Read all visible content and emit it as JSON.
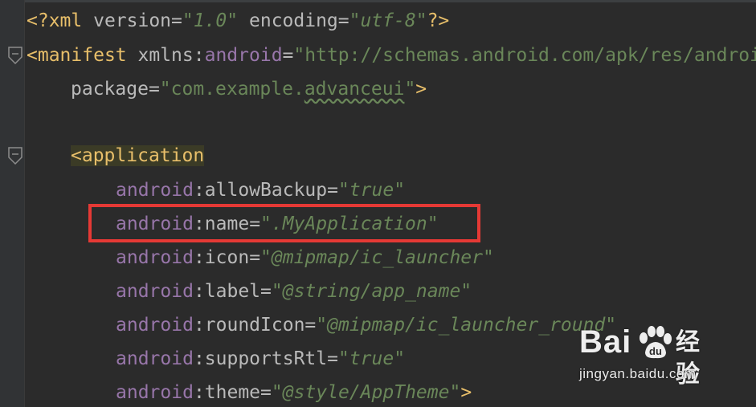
{
  "editor": {
    "language": "xml",
    "colors": {
      "background": "#2b2b2b",
      "tag": "#e8bf6a",
      "namespace": "#9876aa",
      "attribute": "#bababa",
      "value": "#6a8759",
      "highlight_box": "#e53935"
    },
    "line0": {
      "open": "<?xml ",
      "attr1": "version",
      "eq1": "=",
      "val1": "\"1.0\"",
      "space": " ",
      "attr2": "encoding",
      "eq2": "=",
      "val2": "\"utf-8\"",
      "close": "?>"
    },
    "line1": {
      "open": "<",
      "tag": "manifest",
      "space": " ",
      "attr": "xmlns",
      "colon": ":",
      "ns": "android",
      "eq": "=",
      "val": "\"http://schemas.android.com/apk/res/android\""
    },
    "line2": {
      "attr": "package",
      "eq": "=",
      "val_pre": "\"com.example.",
      "val_squiggle": "advanceui",
      "val_post": "\"",
      "close": ">"
    },
    "line4": {
      "open": "<",
      "tag": "application"
    },
    "attrs": [
      {
        "ns": "android",
        "colon": ":",
        "name": "allowBackup",
        "eq": "=",
        "val": "\"true\""
      },
      {
        "ns": "android",
        "colon": ":",
        "name": "name",
        "eq": "=",
        "val": "\".MyApplication\""
      },
      {
        "ns": "android",
        "colon": ":",
        "name": "icon",
        "eq": "=",
        "val": "\"@mipmap/ic_launcher\""
      },
      {
        "ns": "android",
        "colon": ":",
        "name": "label",
        "eq": "=",
        "val": "\"@string/app_name\""
      },
      {
        "ns": "android",
        "colon": ":",
        "name": "roundIcon",
        "eq": "=",
        "val": "\"@mipmap/ic_launcher_round\""
      },
      {
        "ns": "android",
        "colon": ":",
        "name": "supportsRtl",
        "eq": "=",
        "val": "\"true\""
      },
      {
        "ns": "android",
        "colon": ":",
        "name": "theme",
        "eq": "=",
        "val": "\"@style/AppTheme\"",
        "close": ">"
      }
    ]
  },
  "watermark": {
    "logo_text": "Bai",
    "brand_cn": "经验",
    "url": "jingyan.baidu.com"
  }
}
